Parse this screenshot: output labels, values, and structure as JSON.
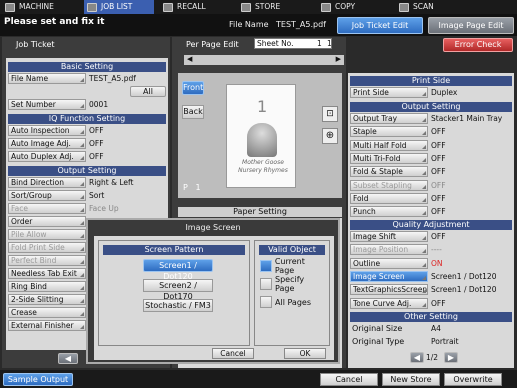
{
  "tabs": [
    {
      "label": "MACHINE",
      "active": false
    },
    {
      "label": "JOB LIST",
      "active": true
    },
    {
      "label": "RECALL",
      "active": false
    },
    {
      "label": "STORE",
      "active": false
    },
    {
      "label": "COPY",
      "active": false
    },
    {
      "label": "SCAN",
      "active": false
    }
  ],
  "header": {
    "message": "Please set and fix it",
    "file_name_label": "File Name",
    "file_name": "TEST_A5.pdf",
    "tab_job_ticket_edit": "Job Ticket Edit",
    "tab_image_page_edit": "Image Page Edit"
  },
  "left": {
    "title": "Job Ticket",
    "basic_setting": "Basic Setting",
    "file_name_label": "File Name",
    "file_name_value": "TEST_A5.pdf",
    "all_button": "All",
    "set_number_label": "Set Number",
    "set_number_value": "0001",
    "iq_function": "IQ Function Setting",
    "iq_rows": [
      {
        "label": "Auto Inspection",
        "value": "OFF"
      },
      {
        "label": "Auto Image Adj.",
        "value": "OFF"
      },
      {
        "label": "Auto Duplex Adj.",
        "value": "OFF"
      }
    ],
    "output_setting": "Output Setting",
    "out_rows": [
      {
        "label": "Bind Direction",
        "value": "Right & Left",
        "dis": false
      },
      {
        "label": "Sort/Group",
        "value": "Sort",
        "dis": false
      },
      {
        "label": "Face",
        "value": "Face Up",
        "dis": true
      },
      {
        "label": "Order",
        "value": "",
        "dis": false
      },
      {
        "label": "Pile Allow",
        "value": "",
        "dis": true
      },
      {
        "label": "Fold Print Side",
        "value": "",
        "dis": true
      },
      {
        "label": "Perfect Bind",
        "value": "",
        "dis": true
      },
      {
        "label": "Needless Tab Exit",
        "value": "",
        "dis": false
      },
      {
        "label": "Ring Bind",
        "value": "",
        "dis": false
      },
      {
        "label": "2-Side Slitting",
        "value": "",
        "dis": false
      },
      {
        "label": "Crease",
        "value": "",
        "dis": false
      },
      {
        "label": "External Finisher",
        "value": "",
        "dis": false
      }
    ]
  },
  "center": {
    "per_page_edit": "Per Page Edit",
    "sheet_no_label": "Sheet No.",
    "sheet_no_value": "1",
    "sheet_no_total": "1",
    "front": "Front",
    "back": "Back",
    "page_label": "P",
    "page_value": "1",
    "preview_number": "1",
    "preview_caption_1": "Mother Goose",
    "preview_caption_2": "Nursery Rhymes",
    "paper_setting": "Paper Setting",
    "error_check": "Error Check"
  },
  "right": {
    "print_side": "Print Side",
    "print_side_rows": [
      {
        "label": "Print Side",
        "value": "Duplex"
      }
    ],
    "output_setting": "Output Setting",
    "output_rows": [
      {
        "label": "Output Tray",
        "value": "Stacker1 Main Tray",
        "dis": false,
        "red": false,
        "sel": false
      },
      {
        "label": "Staple",
        "value": "OFF",
        "dis": false,
        "red": false,
        "sel": false
      },
      {
        "label": "Multi Half Fold",
        "value": "OFF",
        "dis": false,
        "red": false,
        "sel": false
      },
      {
        "label": "Multi Tri-Fold",
        "value": "OFF",
        "dis": false,
        "red": false,
        "sel": false
      },
      {
        "label": "Fold & Staple",
        "value": "OFF",
        "dis": false,
        "red": false,
        "sel": false
      },
      {
        "label": "Subset Stapling",
        "value": "OFF",
        "dis": true,
        "red": false,
        "sel": false
      },
      {
        "label": "Fold",
        "value": "OFF",
        "dis": false,
        "red": false,
        "sel": false
      },
      {
        "label": "Punch",
        "value": "OFF",
        "dis": false,
        "red": false,
        "sel": false
      }
    ],
    "quality": "Quality Adjustment",
    "quality_rows": [
      {
        "label": "Image Shift",
        "value": "OFF",
        "dis": false,
        "red": false,
        "sel": false
      },
      {
        "label": "Image Position",
        "value": "----",
        "dis": true,
        "red": false,
        "sel": false
      },
      {
        "label": "Outline",
        "value": "ON",
        "dis": false,
        "red": true,
        "sel": false
      },
      {
        "label": "Image Screen",
        "value": "Screen1 / Dot120",
        "dis": false,
        "red": false,
        "sel": true
      },
      {
        "label": "TextGraphicsScreen",
        "value": "Screen1 / Dot120",
        "dis": false,
        "red": false,
        "sel": false
      },
      {
        "label": "Tone Curve Adj.",
        "value": "OFF",
        "dis": false,
        "red": false,
        "sel": false
      }
    ],
    "other": "Other Setting",
    "other_rows": [
      {
        "label": "Original Size",
        "value": "A4"
      },
      {
        "label": "Original Type",
        "value": "Portrait"
      }
    ],
    "pager": "1/2"
  },
  "dialog": {
    "title": "Image Screen",
    "screen_pattern": "Screen Pattern",
    "valid_object": "Valid Object",
    "screens": [
      "Screen1 / Dot120",
      "Screen2 / Dot170",
      "Stochastic / FM3"
    ],
    "selected_screen": 0,
    "objects": [
      "Current Page",
      "Specify Page",
      "All Pages"
    ],
    "selected_object": 0,
    "cancel": "Cancel",
    "ok": "OK"
  },
  "footer": {
    "sample_output": "Sample Output",
    "cancel": "Cancel",
    "new_store": "New Store",
    "overwrite": "Overwrite"
  },
  "colors": {
    "accent": "#2e6cc0",
    "header_dark": "#3a4f86",
    "error": "#b02828"
  }
}
